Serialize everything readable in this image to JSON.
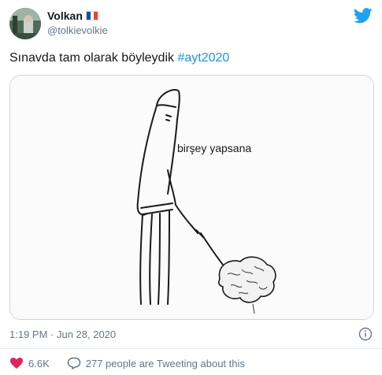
{
  "author": {
    "name": "Volkan",
    "handle": "@tolkievolkie",
    "flag_colors": [
      "#0055a4",
      "#ffffff",
      "#ef4135"
    ]
  },
  "tweet": {
    "text_plain": "Sınavda tam olarak böyleydik",
    "hashtag": "#ayt2020",
    "media_caption": "birşey yapsana",
    "timestamp": "1:19 PM · Jun 28, 2020"
  },
  "actions": {
    "likes": "6.6K",
    "tweeting": "277 people are Tweeting about this"
  },
  "colors": {
    "brand": "#1da1f2",
    "like": "#e0245e",
    "hashtag": "#1b95e0",
    "muted": "#657786",
    "border": "#ccd6dd"
  },
  "icons": [
    "twitter-bird-icon",
    "info-icon",
    "heart-icon",
    "comment-icon"
  ]
}
